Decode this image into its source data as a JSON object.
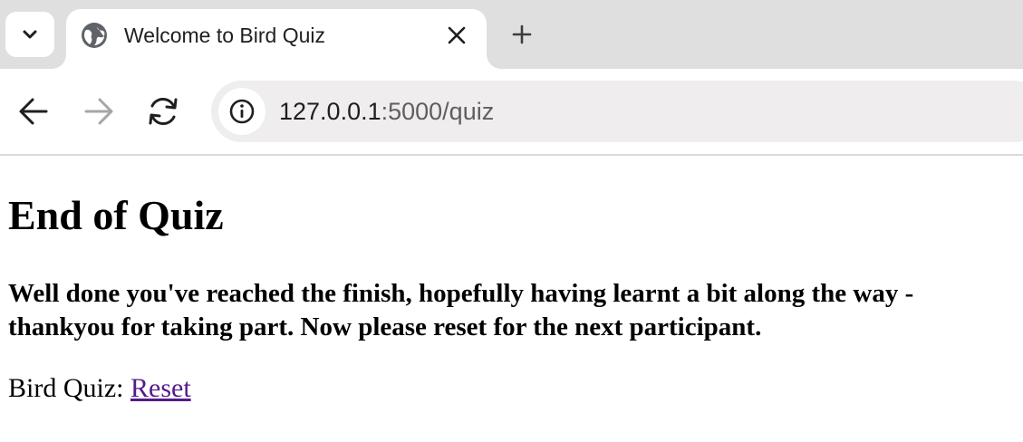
{
  "browser": {
    "tab": {
      "title": "Welcome to Bird Quiz",
      "favicon": "globe-icon"
    },
    "address_bar": {
      "host": "127.0.0.1",
      "path": ":5000/quiz",
      "site_info_icon": "info-icon"
    },
    "buttons": {
      "tab_search": "chevron-down-icon",
      "close_tab": "close-icon",
      "new_tab": "plus-icon",
      "back": "arrow-left-icon",
      "forward": "arrow-right-icon",
      "reload": "reload-icon"
    },
    "colors": {
      "tabbar_bg": "#dfdfdf",
      "omnibox_bg": "#efeded",
      "visited_link": "#551a8b"
    }
  },
  "page": {
    "heading": "End of Quiz",
    "message": "Well done you've reached the finish, hopefully having learnt a bit along the way - thankyou for taking part. Now please reset for the next participant.",
    "reset_prefix": "Bird Quiz: ",
    "reset_link": "Reset"
  }
}
